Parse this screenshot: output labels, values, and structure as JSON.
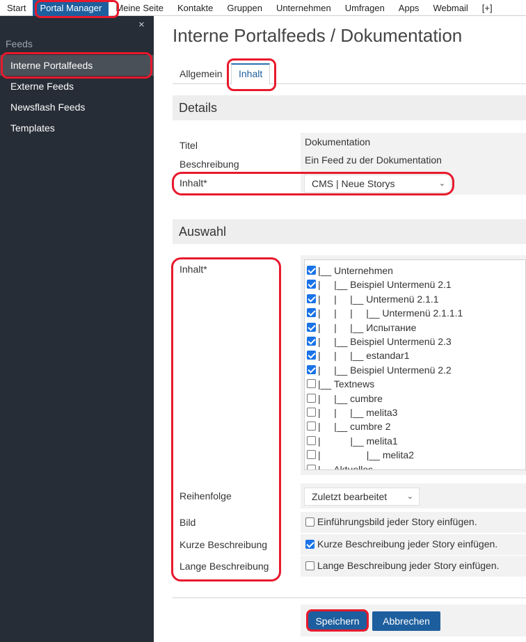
{
  "topnav": {
    "items": [
      "Start",
      "Portal Manager",
      "Meine Seite",
      "Kontakte",
      "Gruppen",
      "Unternehmen",
      "Umfragen",
      "Apps",
      "Webmail",
      "[+]"
    ]
  },
  "sidebar": {
    "close_glyph": "×",
    "section": "Feeds",
    "items": [
      "Interne Portalfeeds",
      "Externe Feeds",
      "Newsflash Feeds",
      "Templates"
    ]
  },
  "page": {
    "title": "Interne Portalfeeds / Dokumentation",
    "tabs": [
      "Allgemein",
      "Inhalt"
    ]
  },
  "details": {
    "heading": "Details",
    "titel_label": "Titel",
    "titel_value": "Dokumentation",
    "beschreibung_label": "Beschreibung",
    "beschreibung_value": "Ein Feed zu der Dokumentation",
    "inhalt_label": "Inhalt*",
    "inhalt_selected": "CMS | Neue Storys"
  },
  "auswahl": {
    "heading": "Auswahl",
    "inhalt_label": "Inhalt*",
    "tree": [
      {
        "text": "|__ Unternehmen",
        "checked": true
      },
      {
        "text": "|     |__ Beispiel Untermenü 2.1",
        "checked": true
      },
      {
        "text": "|     |     |__ Untermenü 2.1.1",
        "checked": true
      },
      {
        "text": "|     |     |     |__ Untermenü 2.1.1.1",
        "checked": true
      },
      {
        "text": "|     |     |__ Испытание",
        "checked": true
      },
      {
        "text": "|     |__ Beispiel Untermenü 2.3",
        "checked": true
      },
      {
        "text": "|     |     |__ estandar1",
        "checked": true
      },
      {
        "text": "|     |__ Beispiel Untermenü 2.2",
        "checked": true
      },
      {
        "text": "|__ Textnews",
        "checked": false
      },
      {
        "text": "|     |__ cumbre",
        "checked": false
      },
      {
        "text": "|     |     |__ melita3",
        "checked": false
      },
      {
        "text": "|     |__ cumbre 2",
        "checked": false
      },
      {
        "text": "|           |__ melita1",
        "checked": false
      },
      {
        "text": "|                 |__ melita2",
        "checked": false
      },
      {
        "text": "|__ Aktuelles",
        "checked": false
      }
    ],
    "reihenfolge_label": "Reihenfolge",
    "reihenfolge_selected": "Zuletzt bearbeitet",
    "bild_label": "Bild",
    "bild_option": "Einführungsbild jeder Story einfügen.",
    "bild_checked": false,
    "kurz_label": "Kurze Beschreibung",
    "kurz_option": "Kurze Beschreibung jeder Story einfügen.",
    "kurz_checked": true,
    "lang_label": "Lange Beschreibung",
    "lang_option": "Lange Beschreibung jeder Story einfügen.",
    "lang_checked": false
  },
  "buttons": {
    "save": "Speichern",
    "cancel": "Abbrechen"
  },
  "colors": {
    "accent": "#1d5f9e",
    "sidebar": "#262d36",
    "highlight": "#e8192c"
  }
}
